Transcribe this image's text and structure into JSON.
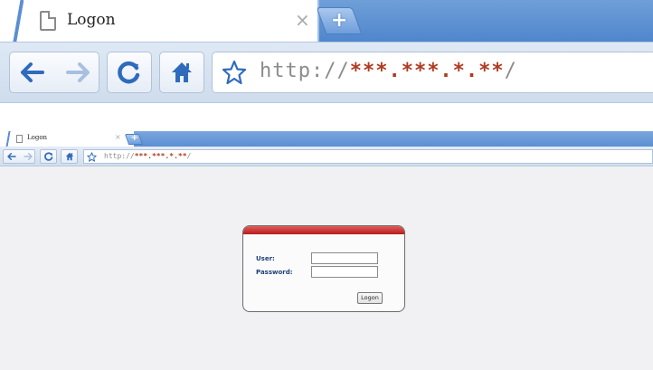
{
  "browser": {
    "tab_title": "Logon",
    "tab_close_glyph": "×",
    "new_tab_glyph": "+",
    "url_scheme": "http://",
    "url_host": "***.***.*.**",
    "url_suffix": "/",
    "icons": [
      "page-icon",
      "back-arrow-icon",
      "forward-arrow-icon",
      "reload-icon",
      "home-icon",
      "bookmark-star-icon"
    ]
  },
  "login": {
    "user_label": "User:",
    "password_label": "Password:",
    "user_value": "",
    "password_value": "",
    "logon_button": "Logon"
  },
  "colors": {
    "tabbar_blue": "#5b8fd2",
    "header_red": "#b51c1c",
    "label_blue": "#1f3f7a",
    "page_background": "#f1f1f4"
  }
}
